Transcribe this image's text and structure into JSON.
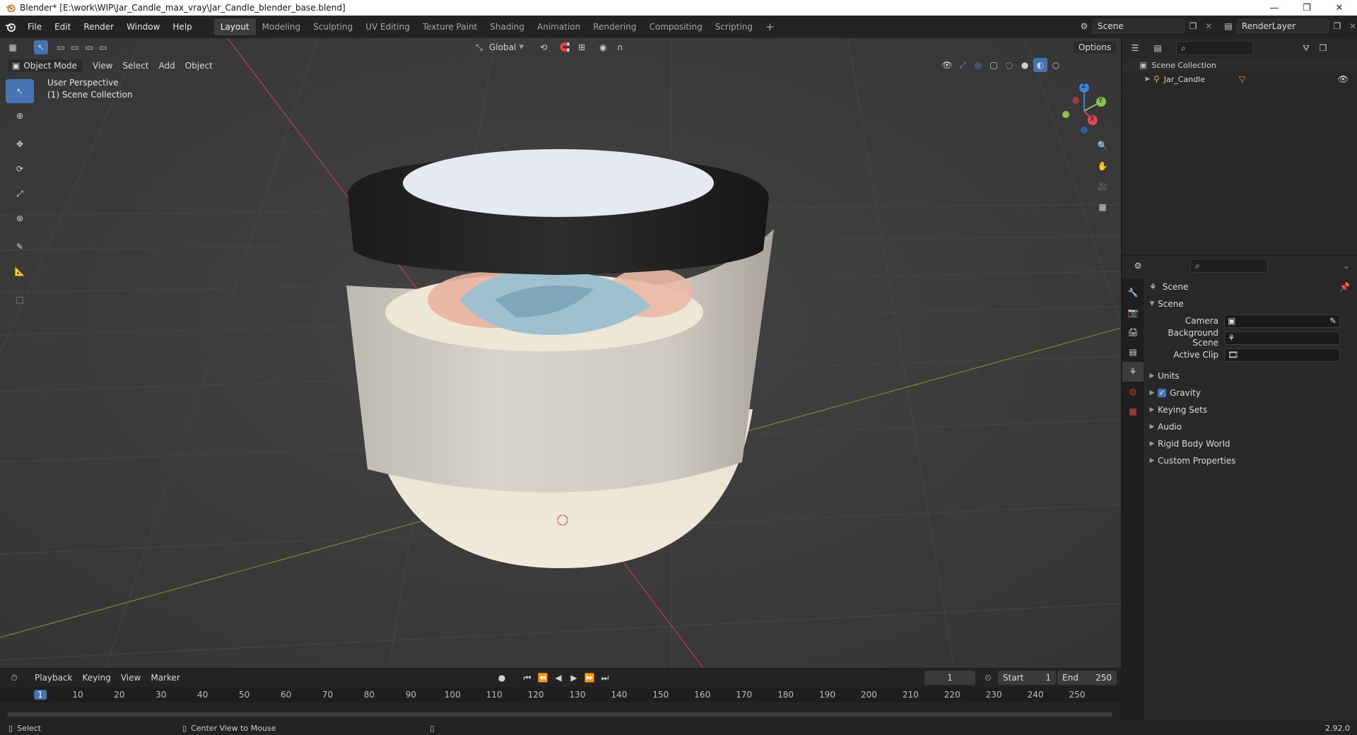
{
  "window": {
    "title": "Blender* [E:\\work\\WIP\\Jar_Candle_max_vray\\Jar_Candle_blender_base.blend]",
    "controls": {
      "minimize": "—",
      "maximize": "❐",
      "close": "✕"
    }
  },
  "menu": [
    "File",
    "Edit",
    "Render",
    "Window",
    "Help"
  ],
  "workspaces": [
    "Layout",
    "Modeling",
    "Sculpting",
    "UV Editing",
    "Texture Paint",
    "Shading",
    "Animation",
    "Rendering",
    "Compositing",
    "Scripting"
  ],
  "active_workspace": "Layout",
  "add_workspace": "+",
  "scene_selector": {
    "value": "Scene"
  },
  "view_layer_selector": {
    "value": "RenderLayer"
  },
  "viewport": {
    "transform_orientation": "Global",
    "options_label": "Options",
    "mode": "Object Mode",
    "header_menus": [
      "View",
      "Select",
      "Add",
      "Object"
    ],
    "overlay_text": {
      "line1": "User Perspective",
      "line2": "(1) Scene Collection"
    },
    "gizmo_axes": {
      "x": "X",
      "y": "Y",
      "z": "Z"
    }
  },
  "outliner": {
    "root": "Scene Collection",
    "items": [
      {
        "label": "Jar_Candle"
      }
    ]
  },
  "properties": {
    "context_label": "Scene",
    "panel_title": "Scene",
    "fields": [
      {
        "label": "Camera",
        "value": ""
      },
      {
        "label": "Background Scene",
        "value": ""
      },
      {
        "label": "Active Clip",
        "value": ""
      }
    ],
    "subpanels": [
      {
        "label": "Units",
        "checkbox": false
      },
      {
        "label": "Gravity",
        "checkbox": true
      },
      {
        "label": "Keying Sets",
        "checkbox": false
      },
      {
        "label": "Audio",
        "checkbox": false
      },
      {
        "label": "Rigid Body World",
        "checkbox": false
      },
      {
        "label": "Custom Properties",
        "checkbox": false
      }
    ]
  },
  "timeline": {
    "menus": [
      "Playback",
      "Keying",
      "View",
      "Marker"
    ],
    "current_frame": "1",
    "start_label": "Start",
    "start_value": "1",
    "end_label": "End",
    "end_value": "250",
    "ruler": [
      "1",
      "10",
      "20",
      "30",
      "40",
      "50",
      "60",
      "70",
      "80",
      "90",
      "100",
      "110",
      "120",
      "130",
      "140",
      "150",
      "160",
      "170",
      "180",
      "190",
      "200",
      "210",
      "220",
      "230",
      "240",
      "250"
    ]
  },
  "statusbar": {
    "left": "Select",
    "middle": "Center View to Mouse",
    "version": "2.92.0"
  },
  "colors": {
    "accent": "#4772b3",
    "x_axis": "#e04a5a",
    "y_axis": "#8bc34a",
    "z_axis": "#3f7fd9"
  }
}
